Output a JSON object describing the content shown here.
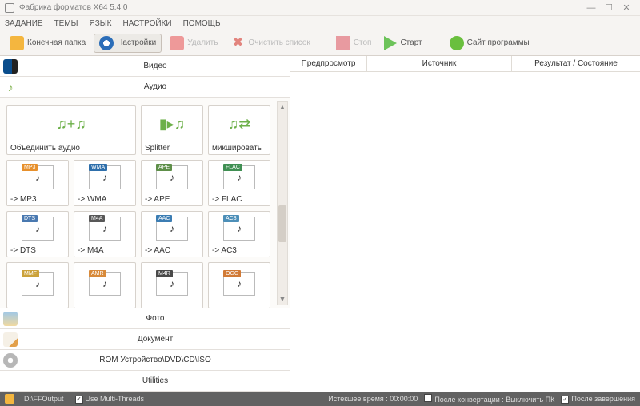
{
  "window": {
    "title": "Фабрика форматов X64 5.4.0",
    "buttons": {
      "min": "—",
      "max": "☐",
      "close": "✕"
    }
  },
  "menubar": [
    "ЗАДАНИЕ",
    "ТЕМЫ",
    "ЯЗЫК",
    "НАСТРОЙКИ",
    "ПОМОЩЬ"
  ],
  "toolbar": {
    "output_folder": "Конечная папка",
    "settings": "Настройки",
    "delete": "Удалить",
    "clear": "Очистить список",
    "stop": "Стоп",
    "start": "Старт",
    "site": "Сайт программы"
  },
  "categories": {
    "video": "Видео",
    "audio": "Аудио",
    "photo": "Фото",
    "document": "Документ",
    "rom": "ROM Устройство\\DVD\\CD\\ISO",
    "utilities": "Utilities"
  },
  "tiles_top": [
    {
      "label": "Объединить аудио"
    },
    {
      "label": "Splitter"
    },
    {
      "label": "микшировать"
    }
  ],
  "tiles": [
    {
      "badge": "MP3",
      "bcolor": "#e7902c",
      "label": "-> MP3"
    },
    {
      "badge": "WMA",
      "bcolor": "#2e6fab",
      "label": "-> WMA"
    },
    {
      "badge": "APE",
      "bcolor": "#5e8f49",
      "label": "-> APE"
    },
    {
      "badge": "FLAC",
      "bcolor": "#3f8f52",
      "label": "-> FLAC"
    },
    {
      "badge": "DTS",
      "bcolor": "#4a79b0",
      "label": "-> DTS"
    },
    {
      "badge": "M4A",
      "bcolor": "#585858",
      "label": "-> M4A"
    },
    {
      "badge": "AAC",
      "bcolor": "#3c7db3",
      "label": "-> AAC"
    },
    {
      "badge": "AC3",
      "bcolor": "#4d8fb8",
      "label": "-> AC3"
    },
    {
      "badge": "MMF",
      "bcolor": "#cba23a",
      "label": ""
    },
    {
      "badge": "AMR",
      "bcolor": "#d88a3a",
      "label": ""
    },
    {
      "badge": "M4R",
      "bcolor": "#4a4a4a",
      "label": ""
    },
    {
      "badge": "OGG",
      "bcolor": "#d17a36",
      "label": ""
    }
  ],
  "list_headers": {
    "preview": "Предпросмотр",
    "source": "Источник",
    "result": "Результат / Состояние"
  },
  "statusbar": {
    "output_path": "D:\\FFOutput",
    "multithreads": "Use Multi-Threads",
    "elapsed": "Истекшее время : 00:00:00",
    "after_convert": "После конвертации : Выключить ПК",
    "after_done": "После завершения"
  }
}
